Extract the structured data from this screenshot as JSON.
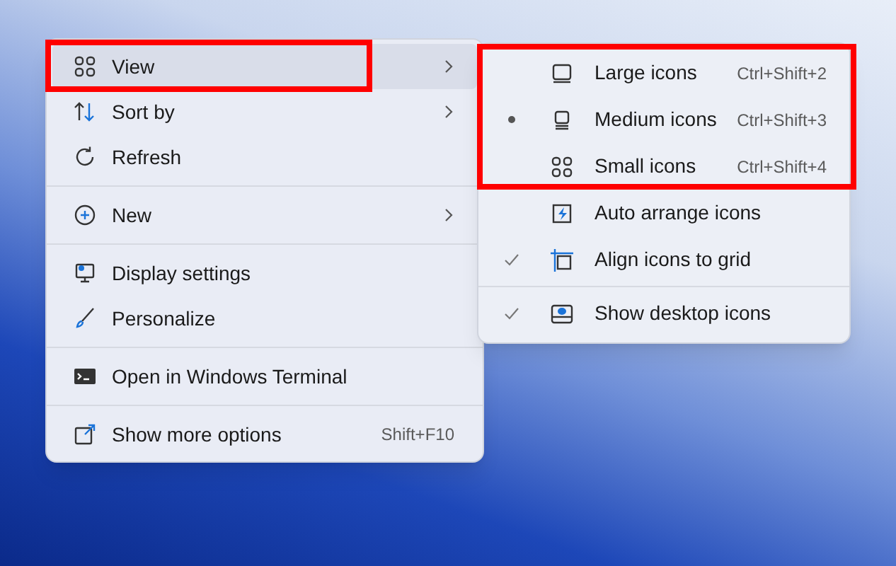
{
  "context_menu": {
    "groups": [
      [
        {
          "label": "View",
          "has_submenu": true,
          "selected": true
        },
        {
          "label": "Sort by",
          "has_submenu": true,
          "selected": false
        },
        {
          "label": "Refresh",
          "has_submenu": false,
          "selected": false
        }
      ],
      [
        {
          "label": "New",
          "has_submenu": true,
          "selected": false
        }
      ],
      [
        {
          "label": "Display settings",
          "has_submenu": false,
          "selected": false
        },
        {
          "label": "Personalize",
          "has_submenu": false,
          "selected": false
        }
      ],
      [
        {
          "label": "Open in Windows Terminal",
          "has_submenu": false,
          "selected": false
        }
      ],
      [
        {
          "label": "Show more options",
          "has_submenu": false,
          "selected": false,
          "shortcut": "Shift+F10"
        }
      ]
    ]
  },
  "view_submenu": {
    "groups": [
      [
        {
          "kind": "radio",
          "label": "Large icons",
          "shortcut": "Ctrl+Shift+2",
          "selected": false
        },
        {
          "kind": "radio",
          "label": "Medium icons",
          "shortcut": "Ctrl+Shift+3",
          "selected": true
        },
        {
          "kind": "radio",
          "label": "Small icons",
          "shortcut": "Ctrl+Shift+4",
          "selected": false
        },
        {
          "kind": "check",
          "label": "Auto arrange icons",
          "checked": false
        },
        {
          "kind": "check",
          "label": "Align icons to grid",
          "checked": true
        }
      ],
      [
        {
          "kind": "check",
          "label": "Show desktop icons",
          "checked": true
        }
      ]
    ]
  }
}
